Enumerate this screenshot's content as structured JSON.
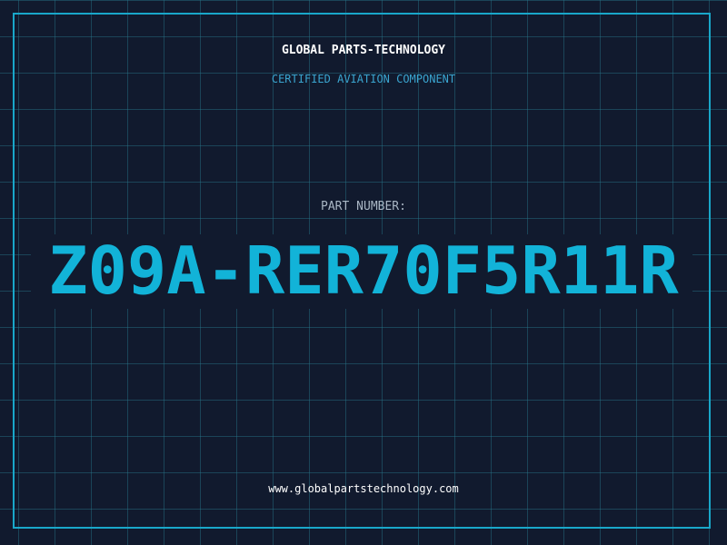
{
  "header": {
    "company": "GLOBAL PARTS-TECHNOLOGY",
    "subtitle": "CERTIFIED AVIATION COMPONENT"
  },
  "part": {
    "label": "PART NUMBER:",
    "number": "Z09A-RER70F5R11R"
  },
  "footer": {
    "website": "www.globalpartstechnology.com"
  },
  "colors": {
    "background": "#111a2e",
    "grid": "#28788c",
    "accent": "#19a7c9",
    "part_number": "#12b3d8",
    "label": "#a9b6c4",
    "text": "#ffffff"
  }
}
